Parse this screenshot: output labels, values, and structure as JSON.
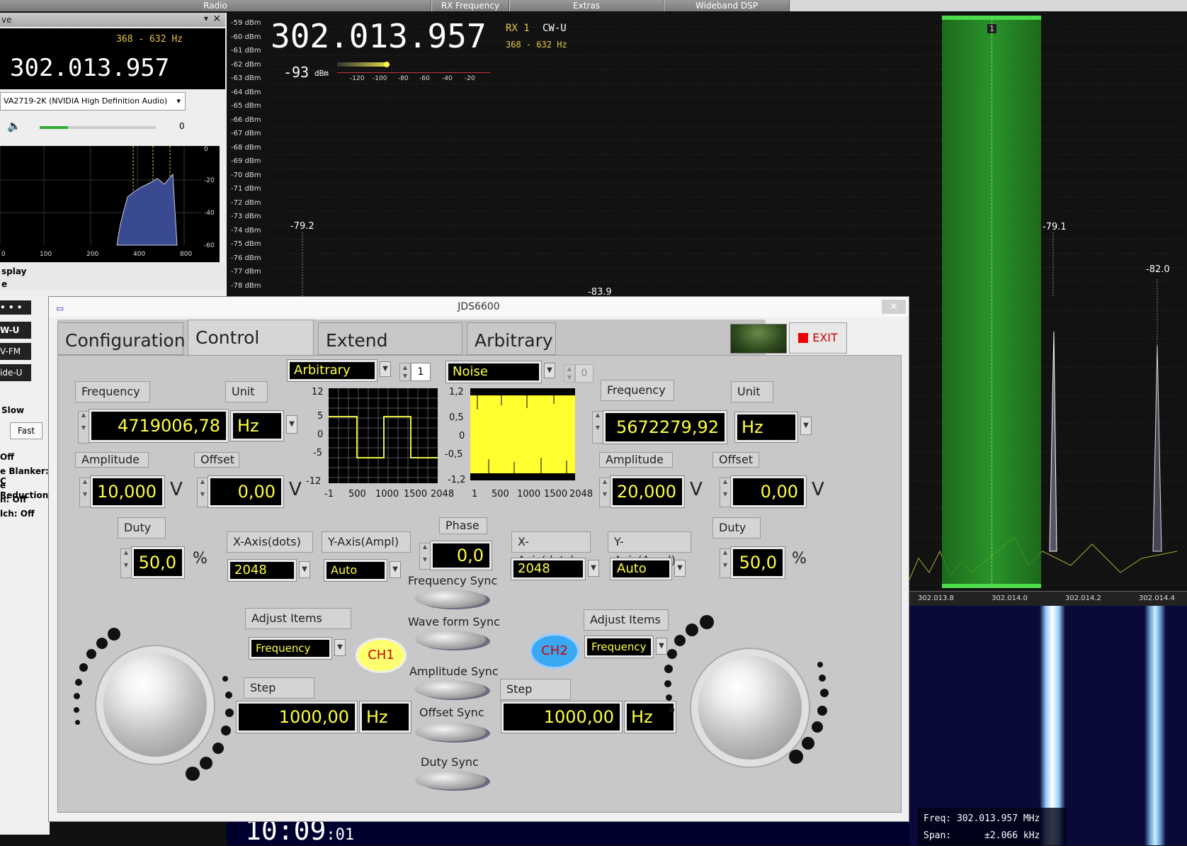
{
  "sdr": {
    "topbar": [
      "Radio",
      "RX Frequency",
      "Extras",
      "Wideband DSP"
    ],
    "left_panel": {
      "header": "ve",
      "filter": "368 - 632 Hz",
      "frequency": "302.013.957",
      "audio_device": "VA2719-2K (NVIDIA High Definition Audio)",
      "volume_value": "0",
      "spec_ticks_x": [
        "0",
        "100",
        "200",
        "400",
        "800"
      ],
      "spec_ticks_y": [
        "0",
        "-20",
        "-40",
        "-60"
      ],
      "display_label": "splay",
      "e_label": "e",
      "modes": [
        "• • •",
        "W-U",
        "V-FM",
        "ide-U"
      ],
      "agc_slow": "Slow",
      "agc_fast": "Fast",
      "status": [
        "Off",
        "e Blanker: C",
        "e Reduction",
        "n: Off",
        "lch: Off"
      ]
    },
    "main": {
      "frequency": "302.013.957",
      "rx": "RX 1",
      "mode": "CW-U",
      "filter": "368 - 632 Hz",
      "signal": "-93",
      "signal_unit": "dBm",
      "meter_ticks": [
        "-120",
        "-100",
        "-80",
        "-60",
        "-40",
        "-20"
      ],
      "dbm_scale": [
        "-59 dBm",
        "-60 dBm",
        "-61 dBm",
        "-62 dBm",
        "-63 dBm",
        "-64 dBm",
        "-65 dBm",
        "-66 dBm",
        "-67 dBm",
        "-68 dBm",
        "-69 dBm",
        "-70 dBm",
        "-71 dBm",
        "-72 dBm",
        "-73 dBm",
        "-74 dBm",
        "-75 dBm",
        "-76 dBm",
        "-77 dBm",
        "-78 dBm"
      ],
      "peak_labels": [
        "-79.2",
        "-83.9",
        "-79.1",
        "-82.0"
      ],
      "band_marker": "1",
      "freq_axis": [
        "302.013.8",
        "302.014.0",
        "302.014.2",
        "302.014.4"
      ],
      "clock": "10:09",
      "clock_sec": ":01",
      "info_freq": "Freq: 302.013.957 MHz",
      "info_span": "Span:      ±2.066 kHz"
    }
  },
  "jds": {
    "title": "JDS6600",
    "tabs": [
      "Configuration",
      "Control Panel",
      "Extend Function",
      "Arbitrary"
    ],
    "active_tab": 1,
    "exit_label": "EXIT",
    "ch1": {
      "frequency_label": "Frequency",
      "frequency": "4719006,78",
      "unit_label": "Unit",
      "unit": "Hz",
      "amplitude_label": "Amplitude",
      "amplitude": "10,000",
      "amplitude_unit": "V",
      "offset_label": "Offset",
      "offset": "0,00",
      "offset_unit": "V",
      "duty_label": "Duty",
      "duty": "50,0",
      "duty_unit": "%",
      "waveform": "Arbitrary",
      "wave_index": "1",
      "xaxis_label": "X-Axis(dots)",
      "xaxis": "2048",
      "yaxis_label": "Y-Axis(Ampl)",
      "yaxis": "Auto",
      "graph_y": [
        "12",
        "5",
        "0",
        "-5",
        "-12"
      ],
      "graph_x": [
        "-1",
        "500",
        "1000",
        "1500",
        "2048"
      ],
      "adjust_label": "Adjust Items",
      "adjust": "Frequency",
      "badge": "CH1",
      "step_label": "Step Value",
      "step": "1000,00",
      "step_unit": "Hz"
    },
    "ch2": {
      "frequency_label": "Frequency",
      "frequency": "5672279,92",
      "unit_label": "Unit",
      "unit": "Hz",
      "amplitude_label": "Amplitude",
      "amplitude": "20,000",
      "amplitude_unit": "V",
      "offset_label": "Offset",
      "offset": "0,00",
      "offset_unit": "V",
      "duty_label": "Duty",
      "duty": "50,0",
      "duty_unit": "%",
      "waveform": "Noise",
      "wave_index": "0",
      "xaxis_label": "X-Axis(dots)",
      "xaxis": "2048",
      "yaxis_label": "Y-Axis(Ampl)",
      "yaxis": "Auto",
      "graph_y": [
        "1,2",
        "0,5",
        "0",
        "-0,5",
        "-1,2"
      ],
      "graph_x": [
        "1",
        "500",
        "1000",
        "1500",
        "2048"
      ],
      "adjust_label": "Adjust Items",
      "adjust": "Frequency",
      "badge": "CH2",
      "step_label": "Step Value",
      "step": "1000,00",
      "step_unit": "Hz"
    },
    "phase_label": "Phase",
    "phase": "0,0",
    "sync": [
      "Frequency Sync",
      "Wave form Sync",
      "Amplitude Sync",
      "Offset Sync",
      "Duty Sync"
    ]
  }
}
